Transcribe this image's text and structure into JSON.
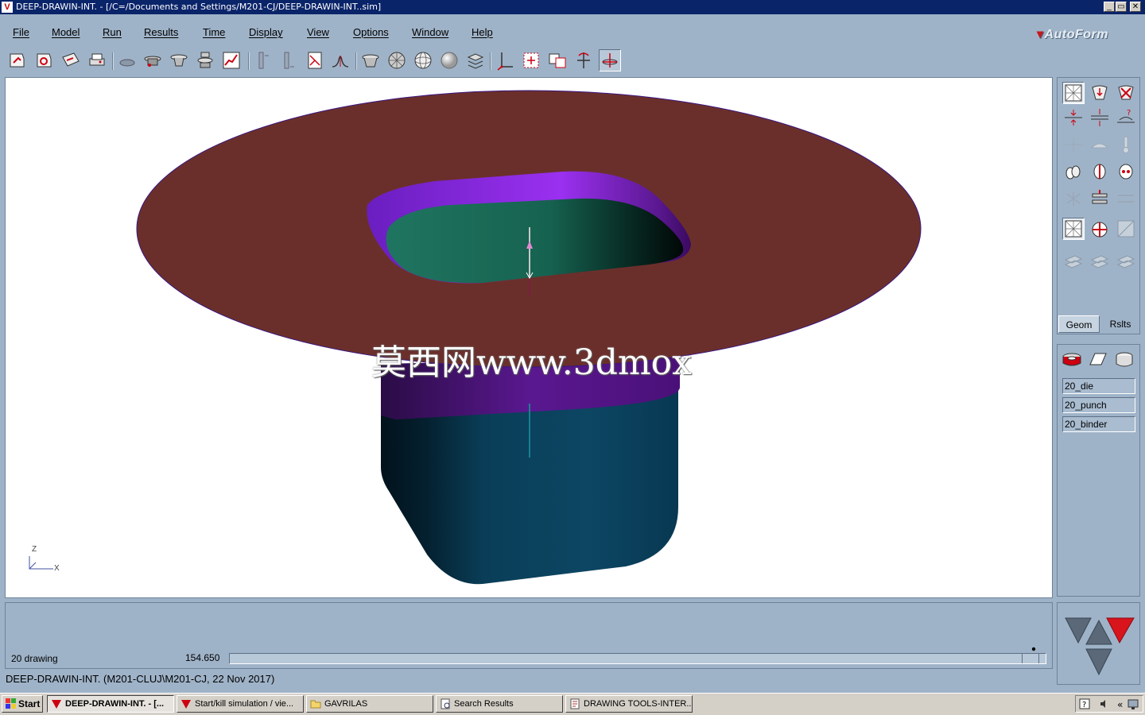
{
  "window": {
    "title": "DEEP-DRAWIN-INT. - [/C=/Documents and Settings/M201-CJ/DEEP-DRAWIN-INT..sim]",
    "app_icon": "autoform-app-icon",
    "controls": {
      "minimize": "_",
      "restore": "▭",
      "close": "✕"
    }
  },
  "menu": {
    "items": [
      "File",
      "Model",
      "Run",
      "Results",
      "Time",
      "Display",
      "View",
      "Options",
      "Window",
      "Help"
    ],
    "logo_text": "AutoForm"
  },
  "toolbar": {
    "icons": [
      "open-sim-icon",
      "save-sim-icon",
      "import-geom-icon",
      "print-icon",
      "tool-setup-icon",
      "die-icon",
      "binder-icon",
      "punch-stack-icon",
      "curve-icon",
      "section-x-icon",
      "section-y-icon",
      "flc-icon",
      "distribution-icon",
      "shaded-tool-icon",
      "mesh-icon",
      "wire-sphere-icon",
      "solid-sphere-icon",
      "layers-icon",
      "axis-icon",
      "fit-view-icon",
      "zoom-box-icon",
      "rotate-icon",
      "pan-view-icon"
    ],
    "active_icon": "pan-view-icon"
  },
  "viewport": {
    "watermark": "莫西网www.3dmox",
    "axis_z": "Z",
    "axis_x": "X",
    "colors": {
      "sheet": "#6b2f2b",
      "wall_purple": "#7a22c8",
      "inner_floor": "#1c6a58",
      "tool_body": "#0d4a66"
    }
  },
  "right_panel": {
    "tab_geom": "Geom",
    "tab_rslts": "Rslts",
    "active_tab": "Geom",
    "icons": [
      "mesh-view-icon",
      "tool-down-icon",
      "tool-close-icon",
      "gap-icon",
      "gap-split-icon",
      "gap-question-icon",
      "drawbead-icon",
      "surface-icon",
      "thermometer-icon",
      "blank-icon",
      "blank-cut-icon",
      "blank-remove-icon",
      "spring-icon",
      "clamp-icon",
      "align-icon",
      "element-mesh-icon",
      "target-icon",
      "surface-grid-icon",
      "layer-a-icon",
      "layer-b-icon",
      "layer-c-icon"
    ]
  },
  "tools_panel": {
    "icons": [
      "die-tool-icon",
      "sheet-tool-icon",
      "cylinder-tool-icon"
    ],
    "tools": [
      "20_die",
      "20_punch",
      "20_binder"
    ]
  },
  "status": {
    "stage": "20 drawing",
    "time_value": "154.650",
    "progress": 1.0,
    "status_line": "DEEP-DRAWIN-INT. (M201-CLUJ\\M201-CJ, 22 Nov 2017)"
  },
  "taskbar": {
    "start": "Start",
    "buttons": [
      "DEEP-DRAWIN-INT. - [...",
      "Start/kill simulation / vie...",
      "GAVRILAS",
      "Search Results",
      "DRAWING TOOLS-INTER..."
    ],
    "active_index": 0
  }
}
